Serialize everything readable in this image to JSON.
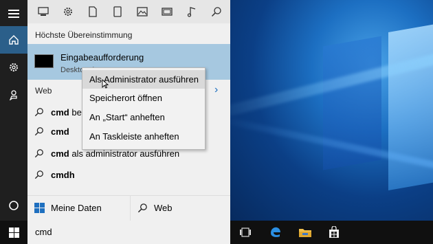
{
  "start_panel": {
    "filters": [
      "apps-filter-icon",
      "settings-filter-icon",
      "documents-filter-icon",
      "tablet-filter-icon",
      "photos-filter-icon",
      "videos-filter-icon",
      "music-filter-icon",
      "search-filter-icon"
    ],
    "best_match_heading": "Höchste Übereinstimmung",
    "best_match": {
      "title": "Eingabeaufforderung",
      "subtitle": "Desktop-App"
    },
    "web_heading": "Web",
    "suggestions": [
      {
        "bold": "cmd",
        "rest": " befehle"
      },
      {
        "bold": "cmd",
        "rest": ""
      },
      {
        "bold": "cmd",
        "rest": " als administrator ausführen"
      },
      {
        "bold": "cmdh",
        "rest": ""
      }
    ],
    "bottom": {
      "my_data": "Meine Daten",
      "web": "Web"
    }
  },
  "context_menu": {
    "items": [
      "Als Administrator ausführen",
      "Speicherort öffnen",
      "An „Start“ anheften",
      "An Taskleiste anheften"
    ],
    "hover_index": 0
  },
  "taskbar": {
    "search_query": "cmd",
    "icons": [
      "task-view-icon",
      "edge-icon",
      "file-explorer-icon",
      "store-icon"
    ]
  },
  "colors": {
    "accent": "#2b5f8a",
    "best_match_bg": "#a6c8e0",
    "link": "#1e6fbf"
  }
}
